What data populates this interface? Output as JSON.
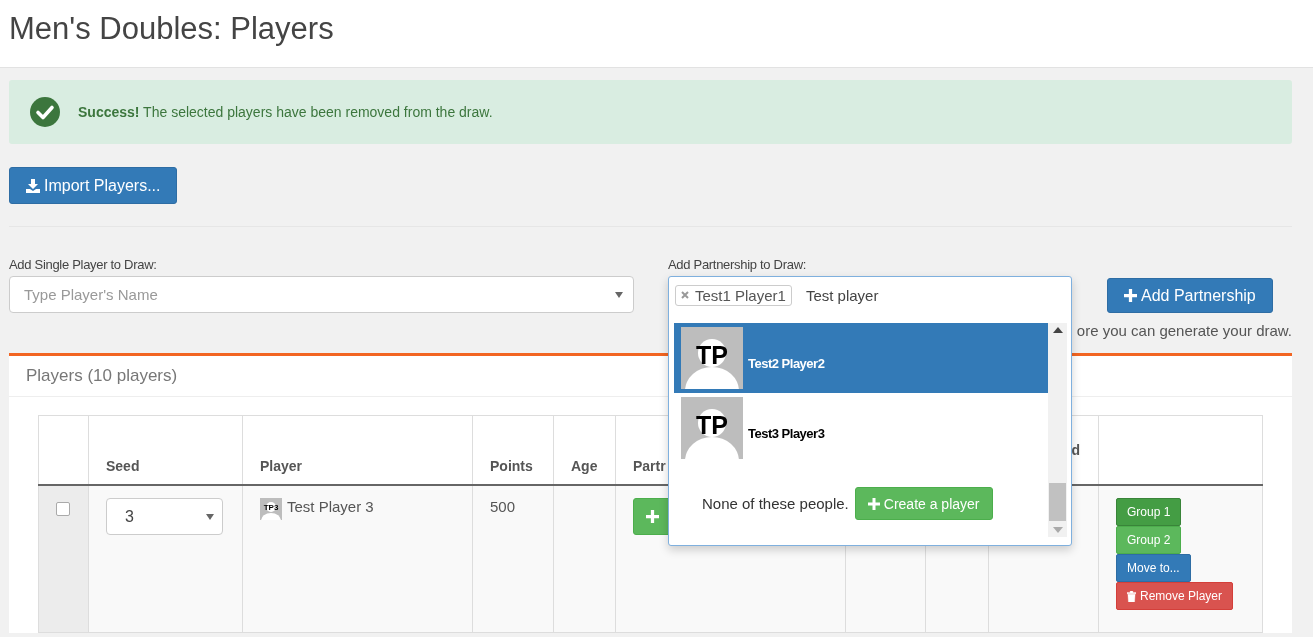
{
  "page": {
    "title": "Men's Doubles: Players"
  },
  "alert": {
    "strong": "Success!",
    "message": "The selected players have been removed from the draw."
  },
  "import_button": "Import Players...",
  "single_player": {
    "label": "Add Single Player to Draw:",
    "placeholder": "Type Player's Name"
  },
  "partnership": {
    "label": "Add Partnership to Draw:",
    "tokens": [
      "Test1 Player1"
    ],
    "value": "Test player",
    "button": "Add Partnership",
    "results": [
      {
        "initials": "TP",
        "name": "Test2 Player2",
        "selected": true
      },
      {
        "initials": "TP",
        "name": "Test3 Player3",
        "selected": false
      }
    ],
    "no_match": "None of these people.",
    "create_button": "Create a player"
  },
  "hint": "ore you can generate your draw.",
  "players_panel": {
    "title": "Players (10 players)",
    "columns": {
      "seed": "Seed",
      "player": "Player",
      "points": "Points",
      "age": "Age",
      "column_6": "Partr",
      "column_9": "d"
    },
    "rows": [
      {
        "checked": false,
        "seed": "3",
        "avatar": "TP3",
        "player": "Test Player 3",
        "points": "500",
        "actions": [
          {
            "label": "Group 1",
            "kind": "group",
            "selected": true
          },
          {
            "label": "Group 2",
            "kind": "group",
            "selected": false
          },
          {
            "label": "Move to...",
            "kind": "move"
          },
          {
            "label": "Remove Player",
            "kind": "remove"
          }
        ]
      }
    ]
  }
}
